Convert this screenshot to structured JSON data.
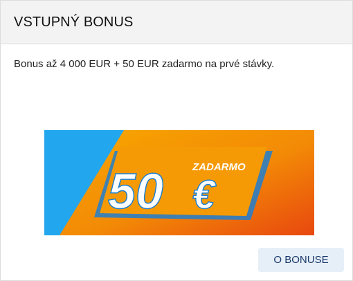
{
  "header": {
    "title": "VSTUPNÝ BONUS"
  },
  "content": {
    "description": "Bonus až 4 000 EUR + 50 EUR zadarmo na prvé stávky."
  },
  "banner": {
    "amount": "50",
    "currency": "€",
    "tag": "ZADARMO",
    "colors": {
      "sky": "#22a6ee",
      "orange": "#f5a100",
      "orange_deep": "#ee5a10",
      "stripe": "#1e7fd0",
      "text": "#ffffff"
    }
  },
  "footer": {
    "button_label": "O BONUSE"
  }
}
